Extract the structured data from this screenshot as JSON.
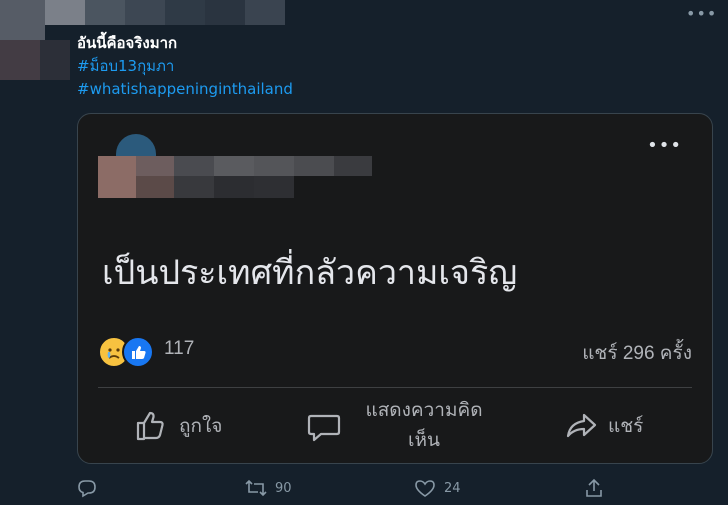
{
  "tweet": {
    "lines": [
      "อันนี้คือจริงมาก",
      "#ม็อบ13กุมภา",
      "#whatishappeninginthailand"
    ]
  },
  "embedded_post": {
    "text": "เป็นประเทศที่กลัวความเจริญ",
    "reaction_count": "117",
    "share_count": "แชร์ 296 ครั้ง",
    "actions": {
      "like": "ถูกใจ",
      "comment": "แสดงความคิดเห็น",
      "share": "แชร์"
    },
    "reaction_icons": [
      "sad-face-icon",
      "thumbs-up-icon"
    ]
  },
  "tweet_actions": {
    "reply_count": "",
    "retweet_count": "90",
    "like_count": "24"
  },
  "colors": {
    "background": "#15202b",
    "hashtag": "#1d9bf0",
    "card_bg": "#18191a",
    "muted": "#8899a6"
  }
}
